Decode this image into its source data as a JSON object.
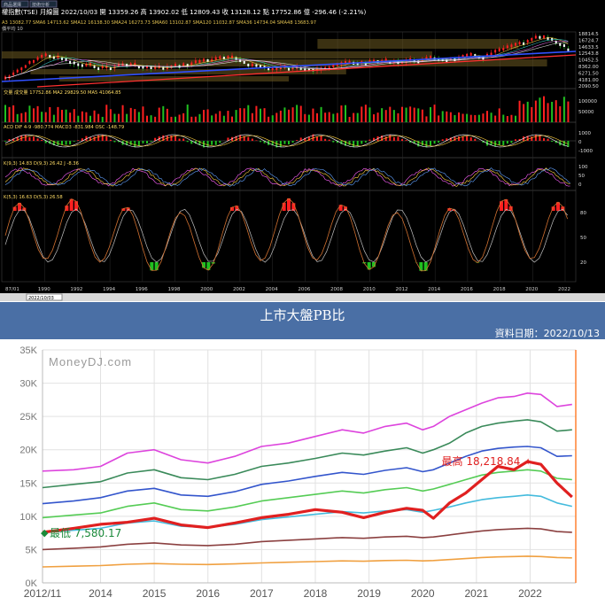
{
  "top_chart": {
    "tab_labels": [
      "商品選擇",
      "技術分析"
    ],
    "header": {
      "name": "權指數(TSE)",
      "period": "月線圖",
      "date": "2022/10/03",
      "open": "開 13359.26",
      "high": "高 13902.02",
      "low": "低 12809.43",
      "close": "收 13128.12",
      "change_label": "點",
      "change": "17752.86 億 -296.46 (-2.21%)"
    },
    "ma_row": "A3 13082.77  SMA6 14713.62  SMA12 16138.30  SMA24 16273.73  SMA60 13102.87  SMA120 11032.87  SMA36 14734.04  SMA48 13683.97",
    "subpanel_label": "價平均 10",
    "price_ticks": [
      "18814.5",
      "16724.7",
      "14633.5",
      "12543.8",
      "10452.5",
      "8362.00",
      "6271.50",
      "4181.00",
      "2090.50"
    ],
    "volume_row": "交量  成交量 17752.86   MA2 29829.50   MA5 41064.85",
    "volume_ticks": [
      "100000",
      "50000"
    ],
    "macd_row": "ACD  DIF 4-9 -980.774   MACD3 -831.984   OSC -148.79",
    "macd_ticks": [
      "1000",
      "0",
      "-1000"
    ],
    "kd1_row": "K(9,3) 14.83   D(9,3) 26.42   J -8.36",
    "kd1_ticks": [
      "100",
      "50",
      "0"
    ],
    "kd2_row": "K(5,3) 16.63   D(5,3) 26.58",
    "kd2_ticks": [
      "80",
      "50",
      "20"
    ],
    "x_ticks": [
      "87/01",
      "1990",
      "1992",
      "1994",
      "1996",
      "1998",
      "2000",
      "2002",
      "2004",
      "2006",
      "2008",
      "2010",
      "2012",
      "2014",
      "2016",
      "2018",
      "2020",
      "2022"
    ],
    "footer_input": "2022/10/03",
    "colors": {
      "bull": "#ff2020",
      "bear": "#20c020",
      "trend_blue": "#3050ff",
      "trend_red": "#ff3030",
      "k_line": "#d07030",
      "d_line": "#c0c0c0",
      "resistance": "#6b5a20"
    }
  },
  "pb_panel": {
    "title": "上市大盤PB比",
    "date": "資料日期：2022/10/13",
    "watermark": "MoneyDJ.com",
    "high_label": "最高 18,218.84",
    "low_label": "最低 7,580.17"
  },
  "chart_data": [
    {
      "type": "line",
      "title": "上市大盤PB比",
      "x": [
        2012.92,
        2013.5,
        2014.0,
        2014.5,
        2015.0,
        2015.5,
        2016.0,
        2016.5,
        2017.0,
        2017.5,
        2018.0,
        2018.5,
        2018.9,
        2019.3,
        2019.7,
        2020.0,
        2020.2,
        2020.5,
        2020.8,
        2021.1,
        2021.4,
        2021.7,
        2021.95,
        2022.2,
        2022.5,
        2022.78
      ],
      "x_ticks": [
        "2012/11",
        "2014",
        "2015",
        "2016",
        "2017",
        "2018",
        "2019",
        "2020",
        "2021",
        "2022"
      ],
      "ylim": [
        0,
        35000
      ],
      "y_ticks": [
        "0K",
        "5K",
        "10K",
        "15K",
        "20K",
        "25K",
        "30K",
        "35K"
      ],
      "grid": true,
      "series": [
        {
          "color": "#dd44dd",
          "values": [
            16800,
            17000,
            17500,
            19500,
            20000,
            18500,
            18000,
            19000,
            20500,
            21000,
            22000,
            23000,
            22500,
            23500,
            24000,
            23000,
            23500,
            25000,
            26000,
            27000,
            27800,
            28000,
            28500,
            28300,
            26500,
            26800
          ]
        },
        {
          "color": "#3a8a5a",
          "values": [
            14300,
            14800,
            15200,
            16500,
            17000,
            15800,
            15500,
            16300,
            17500,
            18000,
            18700,
            19500,
            19200,
            19800,
            20300,
            19500,
            20000,
            21000,
            22500,
            23500,
            24000,
            24300,
            24500,
            24200,
            22800,
            23000
          ]
        },
        {
          "color": "#3355cc",
          "values": [
            11900,
            12300,
            12800,
            13800,
            14200,
            13200,
            13000,
            13700,
            14800,
            15300,
            16000,
            16600,
            16300,
            16900,
            17300,
            16700,
            17000,
            18000,
            19000,
            19800,
            20200,
            20400,
            20500,
            20300,
            19000,
            19100
          ]
        },
        {
          "color": "#55cc55",
          "values": [
            9800,
            10200,
            10500,
            11500,
            12000,
            11000,
            10800,
            11400,
            12300,
            12800,
            13300,
            13800,
            13500,
            14000,
            14300,
            13800,
            14100,
            14800,
            15500,
            16200,
            16600,
            16800,
            17000,
            16800,
            15700,
            15500
          ]
        },
        {
          "color": "#44bbdd",
          "values": [
            7600,
            7900,
            8200,
            9000,
            9300,
            8500,
            8300,
            8800,
            9500,
            9900,
            10300,
            10700,
            10500,
            10800,
            11000,
            10600,
            10900,
            11400,
            12000,
            12500,
            12800,
            13000,
            13200,
            13000,
            12000,
            11500
          ]
        },
        {
          "color": "#e02020",
          "values": [
            7580,
            8200,
            8800,
            9100,
            9700,
            8700,
            8300,
            9000,
            9800,
            10300,
            11000,
            10600,
            9800,
            10600,
            11200,
            10900,
            9700,
            12000,
            13500,
            15500,
            17500,
            17000,
            18219,
            17800,
            15000,
            12900
          ]
        },
        {
          "color": "#8b4040",
          "values": [
            5000,
            5200,
            5400,
            5800,
            6000,
            5700,
            5600,
            5800,
            6200,
            6400,
            6600,
            6800,
            6700,
            6900,
            7000,
            6800,
            6900,
            7200,
            7500,
            7800,
            8000,
            8100,
            8200,
            8100,
            7700,
            7600
          ]
        },
        {
          "color": "#f0a040",
          "values": [
            2400,
            2500,
            2600,
            2800,
            2900,
            2800,
            2750,
            2850,
            3000,
            3100,
            3200,
            3300,
            3250,
            3350,
            3400,
            3300,
            3350,
            3500,
            3650,
            3800,
            3900,
            3950,
            4000,
            3950,
            3800,
            3750
          ]
        }
      ]
    }
  ]
}
